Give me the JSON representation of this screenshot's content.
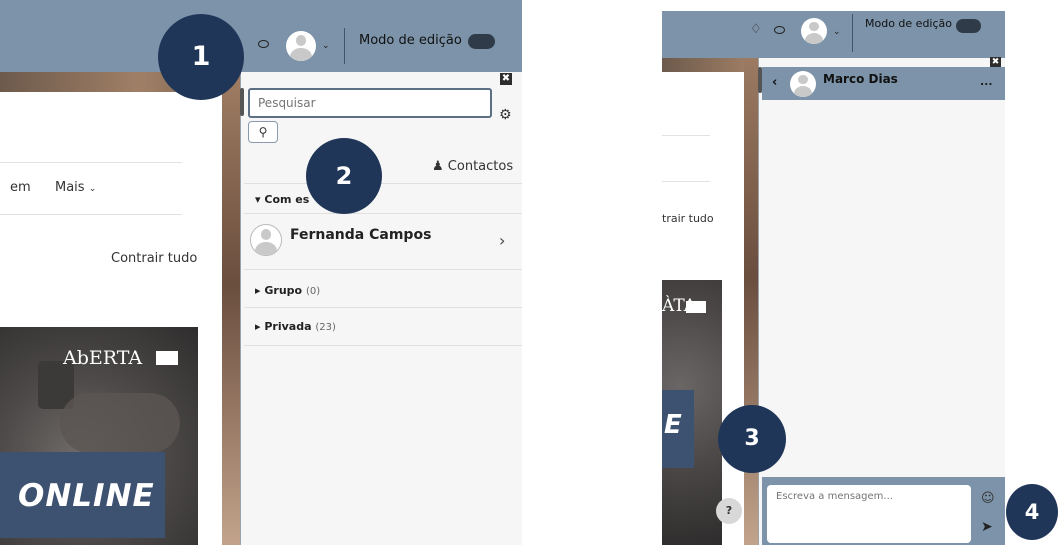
{
  "badges": [
    "1",
    "2",
    "3",
    "4"
  ],
  "navbar": {
    "edit_mode_label": "Modo de edição"
  },
  "page": {
    "nav_em": "em",
    "nav_mais": "Mais",
    "collapse_all": "Contrair tudo",
    "online_text": "ONLINE",
    "online_partial": "E",
    "logo_text": "AbERTA",
    "logo_partial": "ÀTA",
    "help": "?"
  },
  "messages": {
    "search_placeholder": "Pesquisar",
    "contacts_label": "Contactos",
    "starred_label": "Com es",
    "contact_name": "Fernanda Campos",
    "group_label": "Grupo",
    "group_count": "(0)",
    "private_label": "Privada",
    "private_count": "(23)"
  },
  "chat": {
    "contact_name": "Marco Dias",
    "more": "...",
    "input_placeholder": "Escreva a mensagem..."
  },
  "colors": {
    "navbar": "#7c93a9",
    "badge": "#1f3659",
    "drawer": "#f6f6f6"
  }
}
